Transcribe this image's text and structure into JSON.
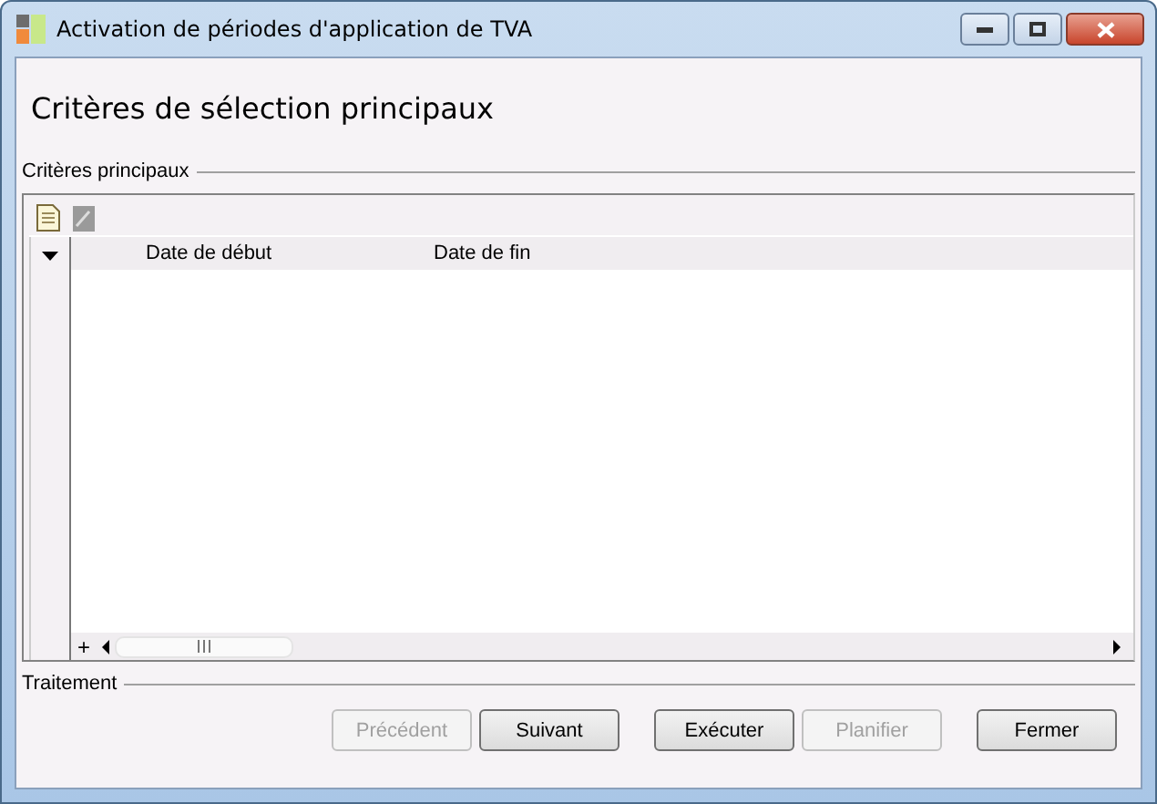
{
  "window": {
    "title": "Activation de périodes d'application de TVA"
  },
  "heading": "Critères de sélection principaux",
  "main_group": {
    "title": "Critères principaux",
    "grid": {
      "columns": [
        "Date de début",
        "Date de fin"
      ],
      "add_row_label": "+"
    }
  },
  "processing_group": {
    "title": "Traitement"
  },
  "buttons": [
    {
      "label": "Précédent",
      "disabled": true
    },
    {
      "label": "Suivant",
      "disabled": false
    },
    {
      "label": "Exécuter",
      "disabled": false
    },
    {
      "label": "Planifier",
      "disabled": true
    },
    {
      "label": "Fermer",
      "disabled": false
    }
  ]
}
